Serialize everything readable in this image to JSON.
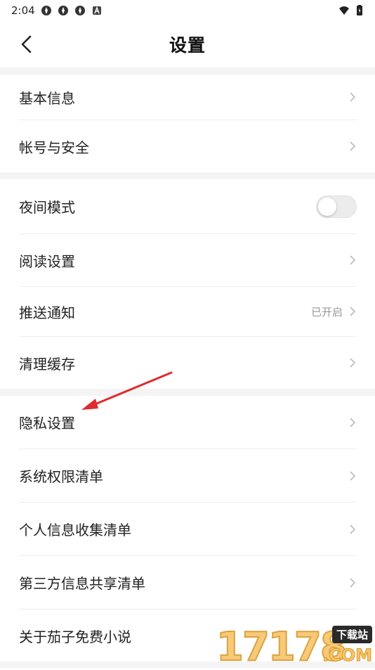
{
  "status_bar": {
    "time": "2:04",
    "icons": [
      "app-icon",
      "app-icon",
      "app-icon",
      "a-icon"
    ],
    "right_icons": [
      "wifi-icon",
      "battery-icon"
    ]
  },
  "nav": {
    "title": "设置",
    "back_icon": "back-arrow-icon"
  },
  "groups": [
    {
      "items": [
        {
          "label": "基本信息"
        },
        {
          "label": "帐号与安全"
        }
      ]
    },
    {
      "items": [
        {
          "label": "夜间模式",
          "toggle": false
        },
        {
          "label": "阅读设置"
        },
        {
          "label": "推送通知",
          "status": "已开启"
        },
        {
          "label": "清理缓存"
        }
      ]
    },
    {
      "items": [
        {
          "label": "隐私设置"
        },
        {
          "label": "系统权限清单"
        },
        {
          "label": "个人信息收集清单"
        },
        {
          "label": "第三方信息共享清单"
        },
        {
          "label": "关于茄子免费小说"
        }
      ]
    }
  ],
  "colors": {
    "gap": "#f4f4f4",
    "chevron": "#bbbbbb",
    "arrow": "#e02b2b",
    "status": "#999999"
  },
  "watermark": {
    "digits": "17178",
    "badge": "下载站",
    "suffix": ".COM"
  }
}
